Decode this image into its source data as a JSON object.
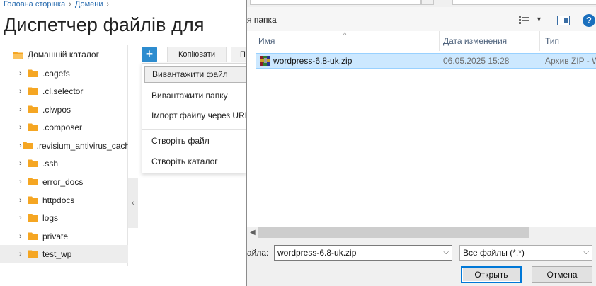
{
  "file_manager": {
    "breadcrumb": [
      "Головна сторінка",
      "Домени"
    ],
    "title": "Диспетчер файлів для",
    "tree": {
      "root_label": "Домашній каталог",
      "items": [
        {
          "label": ".cagefs"
        },
        {
          "label": ".cl.selector"
        },
        {
          "label": ".clwpos"
        },
        {
          "label": ".composer"
        },
        {
          "label": ".revisium_antivirus_cache"
        },
        {
          "label": ".ssh"
        },
        {
          "label": "error_docs"
        },
        {
          "label": "httpdocs"
        },
        {
          "label": "logs"
        },
        {
          "label": "private"
        },
        {
          "label": "test_wp",
          "selected": true
        }
      ]
    },
    "toolbar": {
      "add_symbol": "+",
      "copy_label": "Копіювати",
      "next_label_partial": "Пе"
    },
    "add_menu": {
      "upload_file": "Вивантажити файл",
      "upload_folder": "Вивантажити папку",
      "import_url": "Імпорт файлу через URL",
      "create_file": "Створіть файл",
      "create_folder": "Створіть каталог"
    },
    "colors": {
      "link": "#2a6db0",
      "accent": "#2d8ccf",
      "folder": "#f5a623"
    }
  },
  "dialog": {
    "new_folder_label": "я папка",
    "columns": {
      "name": "Имя",
      "date": "Дата изменения",
      "type": "Тип"
    },
    "files": [
      {
        "name": "wordpress-6.8-uk.zip",
        "date": "06.05.2025 15:28",
        "type": "Архив ZIP - W",
        "selected": true
      }
    ],
    "filename_label": "айла:",
    "filename_value": "wordpress-6.8-uk.zip",
    "filetype_value": "Все файлы (*.*)",
    "open_label": "Открыть",
    "cancel_label": "Отмена",
    "help_symbol": "?",
    "colors": {
      "selection": "#cce8ff",
      "primary_border": "#0078d7",
      "help": "#1a6fbd"
    }
  }
}
